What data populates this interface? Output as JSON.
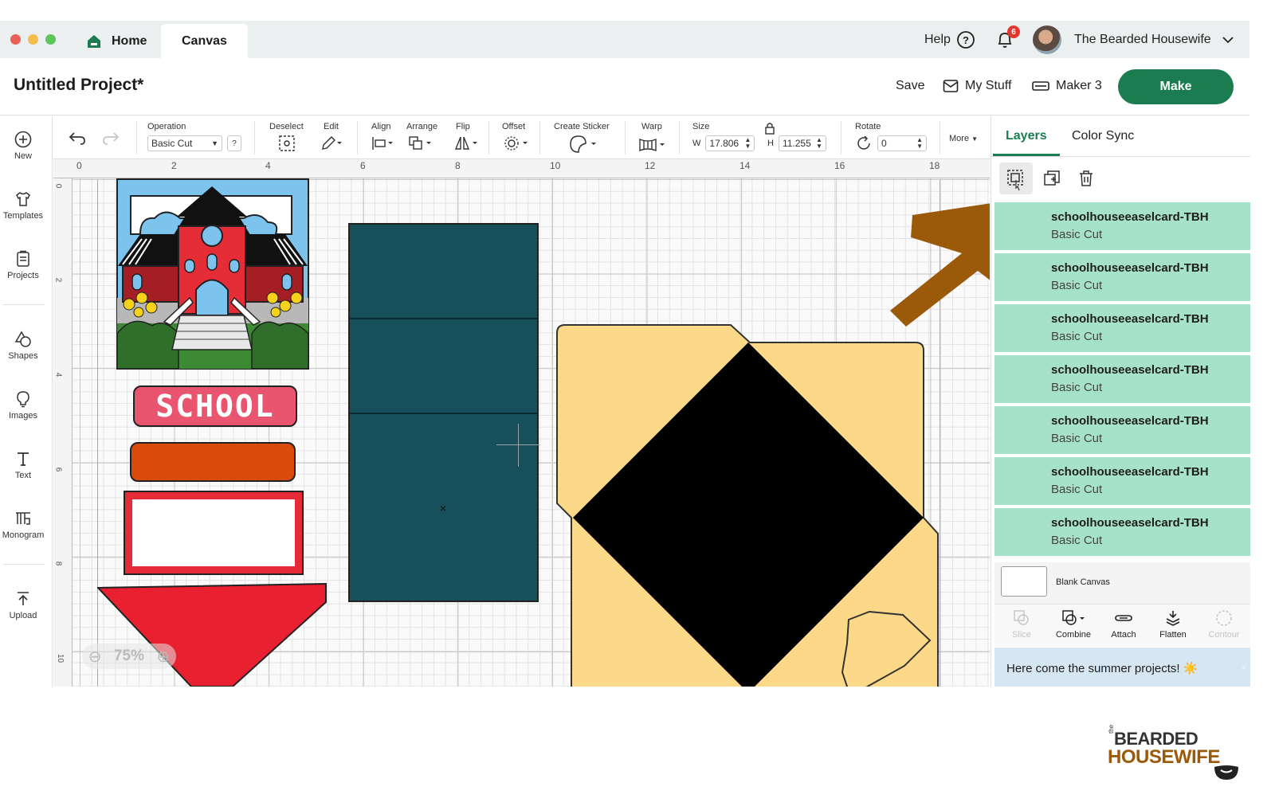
{
  "window": {
    "tabs": [
      {
        "label": "Home"
      },
      {
        "label": "Canvas"
      }
    ],
    "help_label": "Help",
    "notification_count": "6",
    "user_name": "The Bearded Housewife"
  },
  "project": {
    "title": "Untitled Project*",
    "save_label": "Save",
    "mystuff_label": "My Stuff",
    "machine_label": "Maker 3",
    "make_label": "Make"
  },
  "sidebar": {
    "items": [
      {
        "label": "New",
        "icon": "plus-circle-icon"
      },
      {
        "label": "Templates",
        "icon": "shirt-icon"
      },
      {
        "label": "Projects",
        "icon": "projects-icon"
      },
      {
        "label": "Shapes",
        "icon": "shapes-icon"
      },
      {
        "label": "Images",
        "icon": "lightbulb-icon"
      },
      {
        "label": "Text",
        "icon": "text-icon"
      },
      {
        "label": "Monogram",
        "icon": "monogram-icon"
      },
      {
        "label": "Upload",
        "icon": "upload-icon"
      }
    ]
  },
  "toolbar": {
    "operation_label": "Operation",
    "operation_value": "Basic Cut",
    "help_glyph": "?",
    "deselect_label": "Deselect",
    "edit_label": "Edit",
    "align_label": "Align",
    "arrange_label": "Arrange",
    "flip_label": "Flip",
    "offset_label": "Offset",
    "create_sticker_label": "Create Sticker",
    "warp_label": "Warp",
    "size_label": "Size",
    "w_label": "W",
    "w_value": "17.806",
    "h_label": "H",
    "h_value": "11.255",
    "rotate_label": "Rotate",
    "rotate_value": "0",
    "more_label": "More"
  },
  "canvas": {
    "ruler_top": [
      "0",
      "2",
      "4",
      "6",
      "8",
      "10",
      "12",
      "14",
      "16",
      "18"
    ],
    "ruler_left": [
      "0",
      "2",
      "4",
      "6",
      "8",
      "10"
    ],
    "school_text": "SCHOOL",
    "zoom_value": "75%"
  },
  "panel": {
    "tabs": [
      {
        "label": "Layers"
      },
      {
        "label": "Color Sync"
      }
    ],
    "layers": [
      {
        "name": "schoolhouseeaselcard-TBH",
        "operation": "Basic Cut"
      },
      {
        "name": "schoolhouseeaselcard-TBH",
        "operation": "Basic Cut"
      },
      {
        "name": "schoolhouseeaselcard-TBH",
        "operation": "Basic Cut"
      },
      {
        "name": "schoolhouseeaselcard-TBH",
        "operation": "Basic Cut"
      },
      {
        "name": "schoolhouseeaselcard-TBH",
        "operation": "Basic Cut"
      },
      {
        "name": "schoolhouseeaselcard-TBH",
        "operation": "Basic Cut"
      },
      {
        "name": "schoolhouseeaselcard-TBH",
        "operation": "Basic Cut"
      }
    ],
    "blank_canvas_label": "Blank Canvas",
    "actions": [
      {
        "label": "Slice",
        "enabled": false
      },
      {
        "label": "Combine",
        "enabled": true
      },
      {
        "label": "Attach",
        "enabled": true
      },
      {
        "label": "Flatten",
        "enabled": true
      },
      {
        "label": "Contour",
        "enabled": false
      }
    ],
    "banner_text": "Here come the summer projects! ☀️"
  },
  "brand": {
    "line1": "BEARDED",
    "line2": "HOUSEWIFE",
    "prefix": "the"
  },
  "colors": {
    "accent_green": "#1b7d4f",
    "layer_bg": "#a6e2c9",
    "teal_card": "#174f5a",
    "yellow_card": "#fbd988",
    "arrow_brown": "#9a5a0a",
    "brand_brown": "#9a5a0a"
  }
}
